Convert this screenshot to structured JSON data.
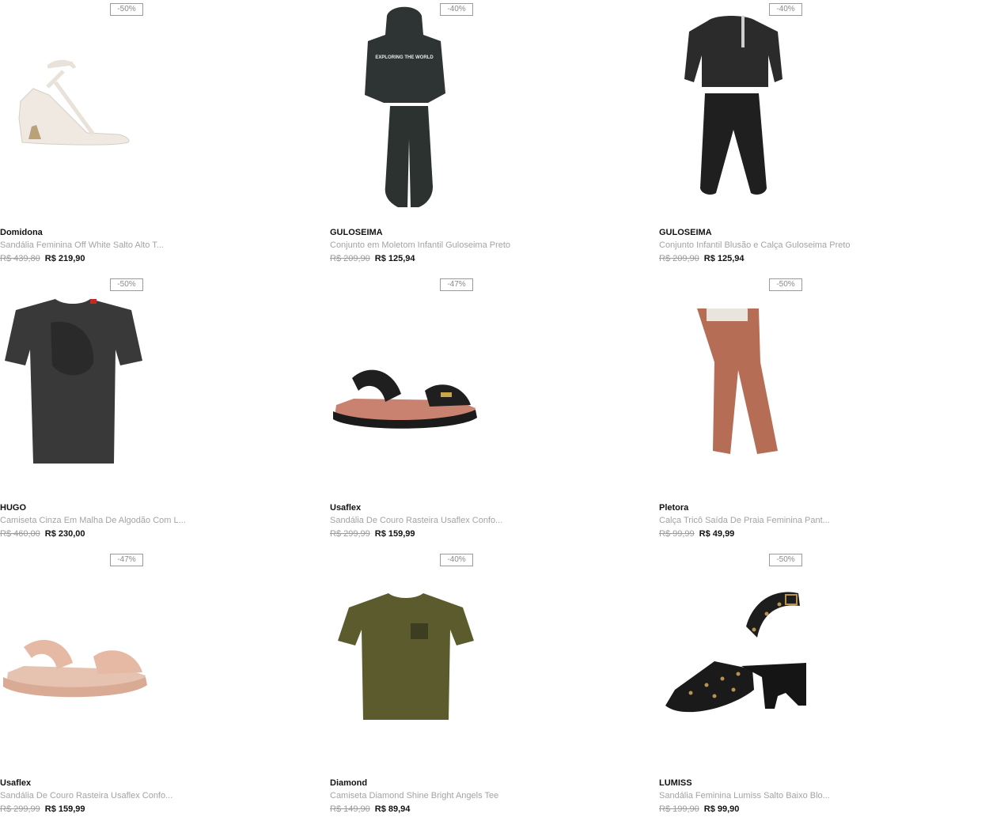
{
  "products": [
    {
      "badge": "-50%",
      "brand": "Domidona",
      "title": "Sandália Feminina Off White Salto Alto T...",
      "old_price": "R$ 439,80",
      "price": "R$ 219,90",
      "image": "white-heeled-sandal"
    },
    {
      "badge": "-40%",
      "brand": "GULOSEIMA",
      "title": "Conjunto em Moletom Infantil Guloseima Preto",
      "old_price": "R$ 209,90",
      "price": "R$ 125,94",
      "image": "dark-hoodie-jogger-set",
      "print_text": "EXPLORING THE WORLD"
    },
    {
      "badge": "-40%",
      "brand": "GULOSEIMA",
      "title": "Conjunto Infantil Blusão e Calça Guloseima Preto",
      "old_price": "R$ 209,90",
      "price": "R$ 125,94",
      "image": "black-sweatshirt-pants-set"
    },
    {
      "badge": "-50%",
      "brand": "HUGO",
      "title": "Camiseta Cinza Em Malha De Algodão Com L...",
      "old_price": "R$ 460,00",
      "price": "R$ 230,00",
      "image": "dark-grey-tshirt"
    },
    {
      "badge": "-47%",
      "brand": "Usaflex",
      "title": "Sandália De Couro Rasteira Usaflex Confo...",
      "old_price": "R$ 299,99",
      "price": "R$ 159,99",
      "image": "black-flat-sandal"
    },
    {
      "badge": "-50%",
      "brand": "Pletora",
      "title": "Calça Tricô Saída De Praia Feminina Pant...",
      "old_price": "R$ 99,99",
      "price": "R$ 49,99",
      "image": "terracotta-knit-pants"
    },
    {
      "badge": "-47%",
      "brand": "Usaflex",
      "title": "Sandália De Couro Rasteira Usaflex Confo...",
      "old_price": "R$ 299,99",
      "price": "R$ 159,99",
      "image": "nude-flat-sandal"
    },
    {
      "badge": "-40%",
      "brand": "Diamond",
      "title": "Camiseta Diamond Shine Bright Angels Tee",
      "old_price": "R$ 149,90",
      "price": "R$ 89,94",
      "image": "olive-tshirt"
    },
    {
      "badge": "-50%",
      "brand": "LUMISS",
      "title": "Sandália Feminina Lumiss Salto Baixo Blo...",
      "old_price": "R$ 199,90",
      "price": "R$ 99,90",
      "image": "black-studded-block-heel-sandal"
    }
  ],
  "colors": {
    "text": "#111111",
    "muted": "#a3a3a3",
    "badge_border": "#9a9a9a"
  }
}
